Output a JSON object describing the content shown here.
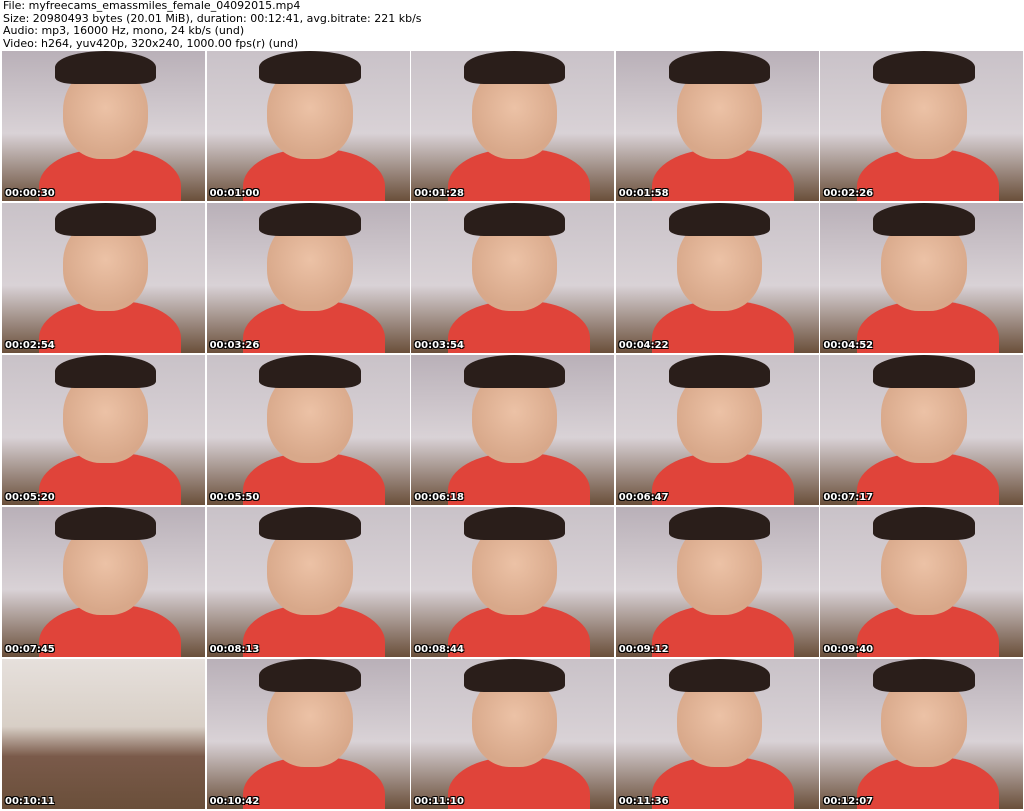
{
  "header": {
    "file": "File: myfreecams_emassmiles_female_04092015.mp4",
    "size": "Size: 20980493 bytes (20.01 MiB), duration: 00:12:41, avg.bitrate: 221 kb/s",
    "audio": "Audio: mp3, 16000 Hz, mono, 24 kb/s (und)",
    "video": "Video: h264, yuv420p, 320x240, 1000.00 fps(r) (und)"
  },
  "colors": {
    "skin": "#d8a88a",
    "dress": "#e0443a",
    "hair": "#2a1e1a",
    "wall": "#c9c2c8",
    "bed": "#6a4f3a"
  },
  "thumbnails": [
    {
      "time": "00:00:30"
    },
    {
      "time": "00:01:00"
    },
    {
      "time": "00:01:28"
    },
    {
      "time": "00:01:58"
    },
    {
      "time": "00:02:26"
    },
    {
      "time": "00:02:54"
    },
    {
      "time": "00:03:26"
    },
    {
      "time": "00:03:54"
    },
    {
      "time": "00:04:22"
    },
    {
      "time": "00:04:52"
    },
    {
      "time": "00:05:20"
    },
    {
      "time": "00:05:50"
    },
    {
      "time": "00:06:18"
    },
    {
      "time": "00:06:47"
    },
    {
      "time": "00:07:17"
    },
    {
      "time": "00:07:45"
    },
    {
      "time": "00:08:13"
    },
    {
      "time": "00:08:44"
    },
    {
      "time": "00:09:12"
    },
    {
      "time": "00:09:40"
    },
    {
      "time": "00:10:11"
    },
    {
      "time": "00:10:42"
    },
    {
      "time": "00:11:10"
    },
    {
      "time": "00:11:36"
    },
    {
      "time": "00:12:07"
    }
  ]
}
